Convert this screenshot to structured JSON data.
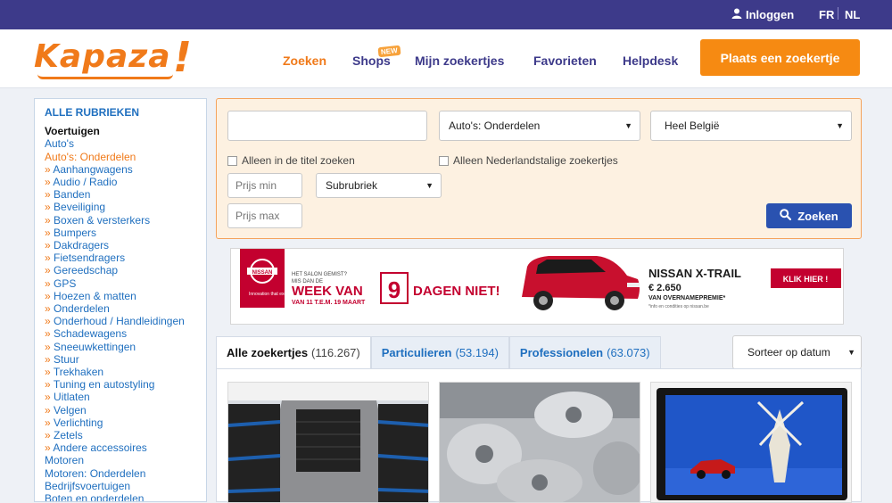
{
  "topbar": {
    "login_label": "Inloggen",
    "lang_fr": "FR",
    "lang_nl": "NL"
  },
  "header": {
    "logo_text": "Kapaza",
    "logo_bang": "!",
    "nav": {
      "zoeken": "Zoeken",
      "shops": "Shops",
      "shops_badge": "NEW",
      "mijn": "Mijn zoekertjes",
      "favorieten": "Favorieten",
      "helpdesk": "Helpdesk"
    },
    "cta": "Plaats een zoekertje"
  },
  "sidebar": {
    "heading": "ALLE RUBRIEKEN",
    "category": "Voertuigen",
    "top_links": [
      "Auto's",
      "Auto's: Onderdelen"
    ],
    "sub_arrow": "»",
    "subitems": [
      "Aanhangwagens",
      "Audio / Radio",
      "Banden",
      "Beveiliging",
      "Boxen & versterkers",
      "Bumpers",
      "Dakdragers",
      "Fietsendragers",
      "Gereedschap",
      "GPS",
      "Hoezen & matten",
      "Onderdelen",
      "Onderhoud / Handleidingen",
      "Schadewagens",
      "Sneeuwkettingen",
      "Stuur",
      "Trekhaken",
      "Tuning en autostyling",
      "Uitlaten",
      "Velgen",
      "Verlichting",
      "Zetels",
      "Andere accessoires"
    ],
    "bottom_links": [
      "Motoren",
      "Motoren: Onderdelen",
      "Bedrijfsvoertuigen",
      "Boten en onderdelen"
    ]
  },
  "search": {
    "query_value": "",
    "category_select": "Auto's: Onderdelen",
    "region_select": "Heel België",
    "check_title": "Alleen in de titel zoeken",
    "check_dutch": "Alleen Nederlandstalige zoekertjes",
    "price_min_placeholder": "Prijs min",
    "price_max_placeholder": "Prijs max",
    "subrubriek_select": "Subrubriek",
    "button": "Zoeken"
  },
  "banner": {
    "brand_tagline": "Innovation that excites",
    "small_line1": "HET SALON GEMIST?",
    "small_line2": "MIS DAN DE",
    "headline_a": "WEEK VAN",
    "headline_num": "9",
    "headline_b": "DAGEN NIET!",
    "date_line": "VAN 11 T.E.M. 19 MAART",
    "model": "NISSAN X-TRAIL",
    "price": "€ 2.650",
    "price_sub": "VAN OVERNAMEPREMIE*",
    "fineprint": "*info en condities op nissan.be",
    "cta": "KLIK HIER !"
  },
  "results": {
    "tabs": [
      {
        "label": "Alle zoekertjes",
        "count": "(116.267)"
      },
      {
        "label": "Particulieren",
        "count": "(53.194)"
      },
      {
        "label": "Professionelen",
        "count": "(63.073)"
      }
    ],
    "sort_select": "Sorteer op datum"
  },
  "colors": {
    "brand_purple": "#3d3a8a",
    "brand_orange": "#f07a1a",
    "link_blue": "#1f6fbf",
    "search_blue": "#2a52b0",
    "nissan_red": "#c3002f"
  }
}
